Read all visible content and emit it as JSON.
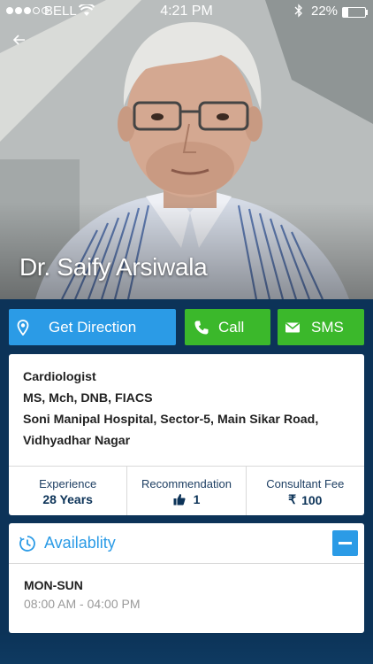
{
  "status_bar": {
    "carrier": "BELL",
    "time": "4:21 PM",
    "battery": "22%",
    "battery_level": 0.22
  },
  "profile": {
    "name": "Dr. Saify Arsiwala"
  },
  "actions": {
    "direction_label": "Get Direction",
    "call_label": "Call",
    "sms_label": "SMS"
  },
  "info": {
    "specialty": "Cardiologist",
    "qualifications": "MS, Mch, DNB, FIACS",
    "address_line1": "Soni Manipal Hospital, Sector-5, Main Sikar Road,",
    "address_line2": "Vidhyadhar Nagar"
  },
  "stats": {
    "experience_label": "Experience",
    "experience_value": "28 Years",
    "recommendation_label": "Recommendation",
    "recommendation_value": "1",
    "fee_label": "Consultant Fee",
    "fee_value": "100",
    "currency_symbol": "₹"
  },
  "availability": {
    "title": "Availablity",
    "days": "MON-SUN",
    "hours": "08:00 AM - 04:00 PM"
  },
  "icons": {
    "back": "arrow-left-icon",
    "direction": "location-pin-icon",
    "call": "phone-icon",
    "sms": "envelope-icon",
    "recommendation": "thumbs-up-icon",
    "availability": "clock-icon",
    "collapse": "minus-icon"
  },
  "colors": {
    "accent_blue": "#2b9be6",
    "accent_green": "#3bb82b",
    "background": "#0c3358"
  }
}
